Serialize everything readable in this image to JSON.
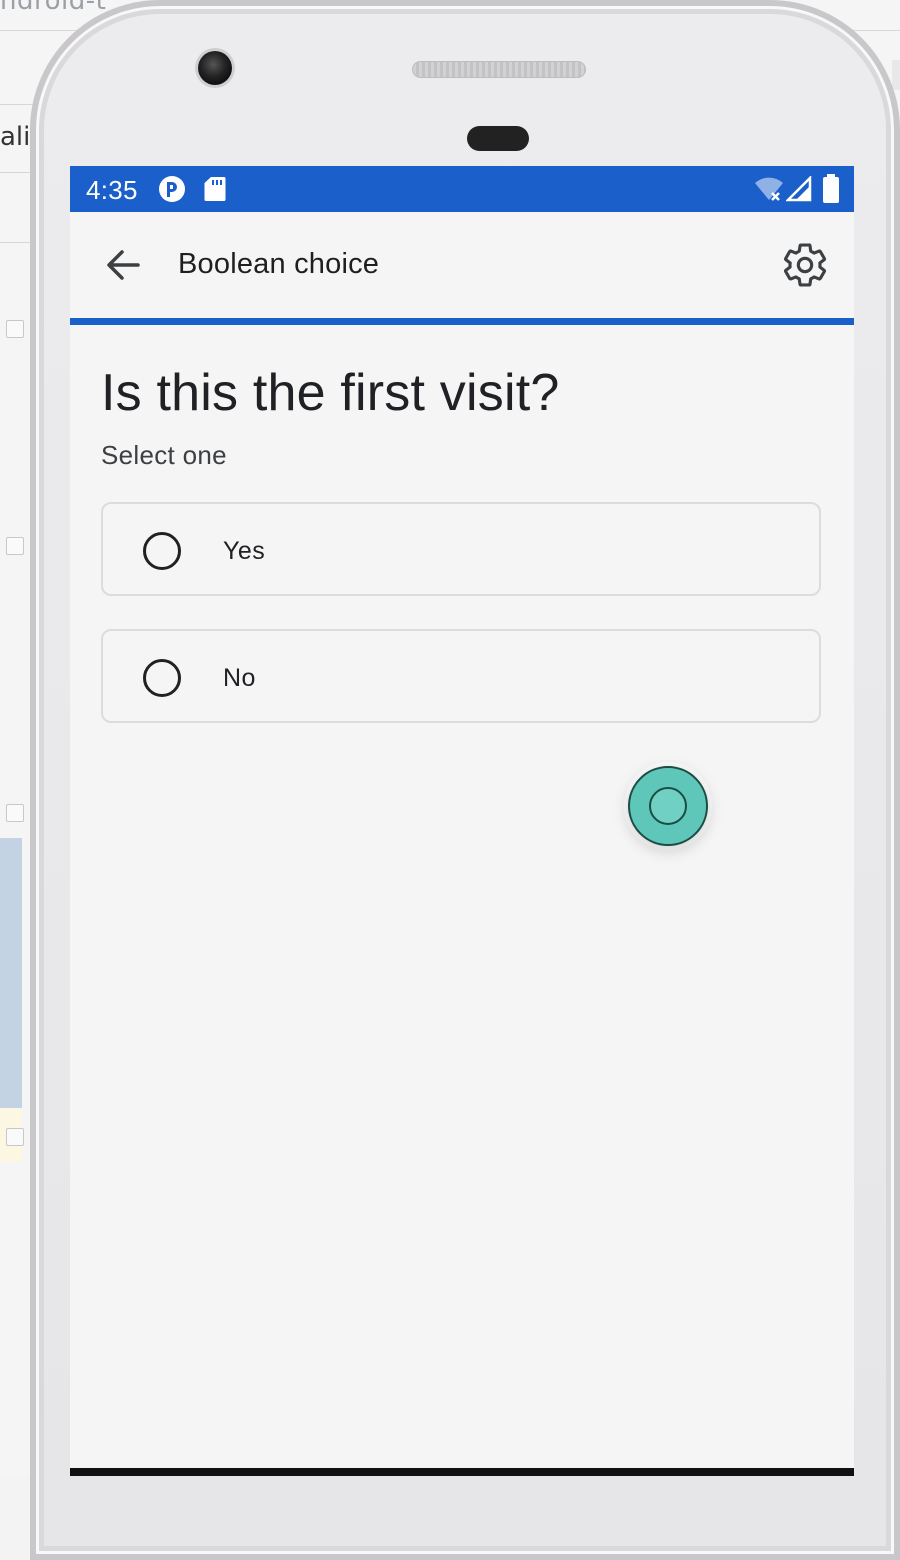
{
  "ide": {
    "tab_fragment": "ndroid-t",
    "left_text": "ali"
  },
  "status_bar": {
    "time": "4:35",
    "icons": [
      "app-notification-icon",
      "sd-card-icon",
      "wifi-off-icon",
      "cell-signal-icon",
      "battery-icon"
    ]
  },
  "app_bar": {
    "title": "Boolean choice",
    "back_icon": "arrow-back-icon",
    "settings_icon": "gear-icon"
  },
  "progress": 1.0,
  "question": {
    "text": "Is this the first visit?",
    "hint": "Select one",
    "options": [
      {
        "label": "Yes",
        "selected": false
      },
      {
        "label": "No",
        "selected": false
      }
    ]
  },
  "colors": {
    "primary": "#1a5fca",
    "touch_indicator": "#5ec7b9"
  }
}
